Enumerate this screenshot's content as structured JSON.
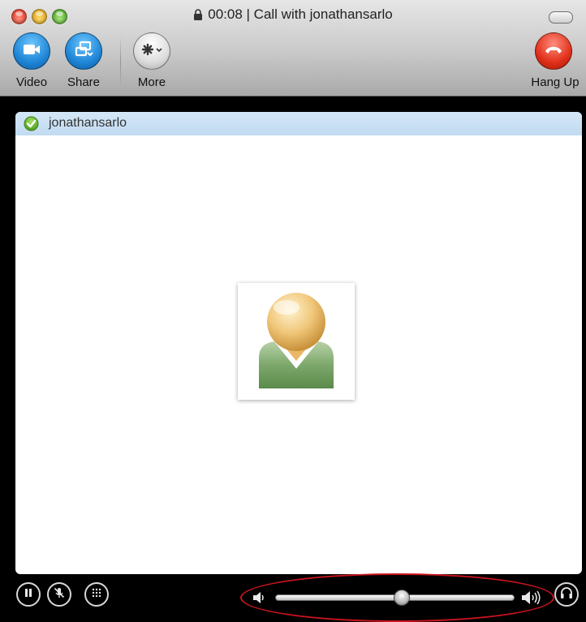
{
  "window": {
    "title": "00:08 | Call with jonathansarlo"
  },
  "toolbar": {
    "video_label": "Video",
    "share_label": "Share",
    "more_label": "More",
    "hangup_label": "Hang Up"
  },
  "contact": {
    "name": "jonathansarlo",
    "status": "online"
  },
  "controls": {
    "volume_level": 0.53,
    "icons": [
      "pause-icon",
      "mute-microphone-icon",
      "dialpad-icon",
      "speaker-low-icon",
      "speaker-high-icon",
      "headset-icon"
    ]
  },
  "colors": {
    "accent_blue": "#1f86d6",
    "hangup_red": "#e0301a",
    "contact_row": "#c8dff3",
    "highlight": "#c9141f"
  }
}
